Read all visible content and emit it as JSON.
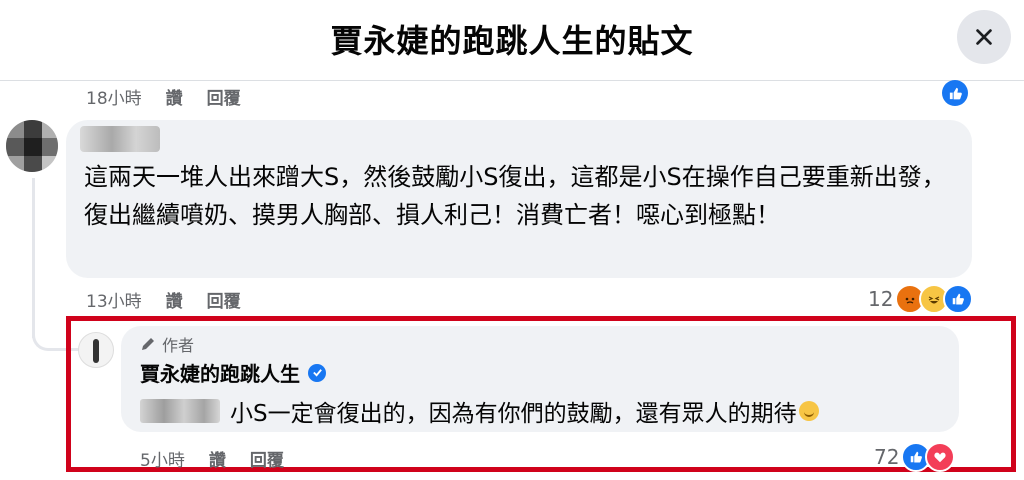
{
  "header": {
    "title": "賈永婕的跑跳人生的貼文"
  },
  "prev_comment": {
    "time": "18小時",
    "like_label": "讚",
    "reply_label": "回覆"
  },
  "comment": {
    "text": "這兩天一堆人出來蹭大S，然後鼓勵小S復出，這都是小S在操作自己要重新出發，復出繼續噴奶、摸男人胸部、損人利己！消費亡者！噁心到極點！",
    "time": "13小時",
    "like_label": "讚",
    "reply_label": "回覆",
    "reaction_count": "12",
    "reactions": [
      "angry-icon",
      "haha-icon",
      "like-icon"
    ]
  },
  "reply": {
    "author_badge": "作者",
    "author_name": "賈永婕的跑跳人生",
    "text": "小S一定會復出的，因為有你們的鼓勵，還有眾人的期待",
    "time": "5小時",
    "like_label": "讚",
    "reply_label": "回覆",
    "reaction_count": "72",
    "reactions": [
      "like-icon",
      "love-icon"
    ]
  },
  "colors": {
    "accent": "#1877f2",
    "highlight": "#d0021b",
    "bubble": "#f0f2f5",
    "meta": "#65676b"
  }
}
